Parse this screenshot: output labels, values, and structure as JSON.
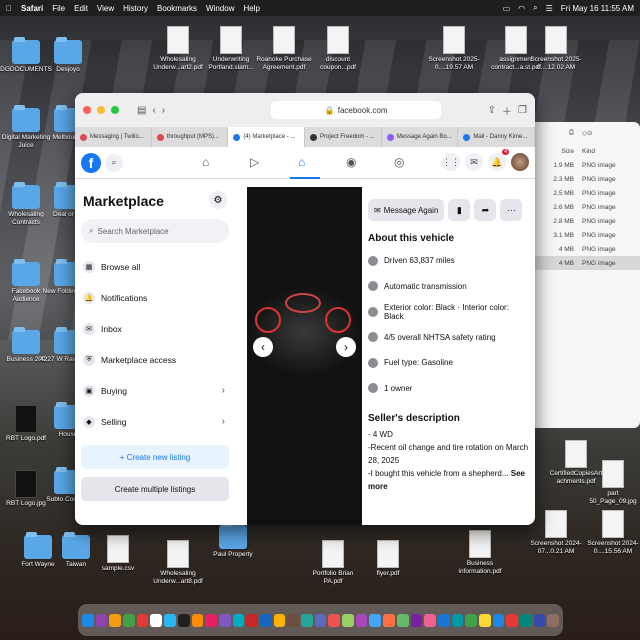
{
  "menubar": {
    "app": "Safari",
    "items": [
      "File",
      "Edit",
      "View",
      "History",
      "Bookmarks",
      "Window",
      "Help"
    ],
    "clock": "Fri May 16  11:55 AM"
  },
  "desktop": {
    "icons": [
      {
        "label": "DGDOCUMENTS",
        "kind": "folder"
      },
      {
        "label": "Desjoyo",
        "kind": "folder"
      },
      {
        "label": "Wholesaling Underw...art2.pdf",
        "kind": "doc"
      },
      {
        "label": "Underwriting Portland.slam...",
        "kind": "doc"
      },
      {
        "label": "Roanoke Purchase Agreement.pdf",
        "kind": "doc"
      },
      {
        "label": "discount coupon...pdf",
        "kind": "doc"
      },
      {
        "label": "Screenshot 2025-0....19.57 AM",
        "kind": "doc"
      },
      {
        "label": "assignment contract...a.st.pdf",
        "kind": "doc"
      },
      {
        "label": "Screenshot 2025-0....12.02 AM",
        "kind": "doc"
      },
      {
        "label": "Digital Marketing Juice",
        "kind": "folder"
      },
      {
        "label": "Melbourne",
        "kind": "folder"
      },
      {
        "label": "Wholesaling Contracts",
        "kind": "folder"
      },
      {
        "label": "Deal or no",
        "kind": "folder"
      },
      {
        "label": "Facebook Audience",
        "kind": "folder"
      },
      {
        "label": "New Folder Items",
        "kind": "folder"
      },
      {
        "label": "Business 200",
        "kind": "folder"
      },
      {
        "label": "4227 W Raven Tr...",
        "kind": "folder"
      },
      {
        "label": "RBT Logo.pdf",
        "kind": "doc"
      },
      {
        "label": "House",
        "kind": "folder"
      },
      {
        "label": "RBT Logo.jpg",
        "kind": "doc"
      },
      {
        "label": "Subto Contract",
        "kind": "folder"
      },
      {
        "label": "Fort Wayne",
        "kind": "folder"
      },
      {
        "label": "Taiwan",
        "kind": "folder"
      },
      {
        "label": "sample.csv",
        "kind": "doc"
      },
      {
        "label": "Wholesaling Underw...art8.pdf",
        "kind": "doc"
      },
      {
        "label": "Paul Property",
        "kind": "folder"
      },
      {
        "label": "Portfolio Brian PA.pdf",
        "kind": "doc"
      },
      {
        "label": "flyer.pdf",
        "kind": "doc"
      },
      {
        "label": "Business information.pdf",
        "kind": "doc"
      },
      {
        "label": "Screenshot 2024-07...0.21 AM",
        "kind": "doc"
      },
      {
        "label": "Screenshot 2024-0....15.56 AM",
        "kind": "doc"
      },
      {
        "label": "CertifiedCopiesArt achments.pdf",
        "kind": "doc"
      },
      {
        "label": "part 50_Page_09.jpg",
        "kind": "doc"
      }
    ]
  },
  "browser": {
    "url": "facebook.com",
    "tabs": [
      {
        "label": "Messaging | Twilio...",
        "color": "#e1474f"
      },
      {
        "label": "throughput (MPS)...",
        "color": "#e1474f"
      },
      {
        "label": "(4) Marketplace - ...",
        "color": "#1877f2"
      },
      {
        "label": "Project Freedom - ...",
        "color": "#333333"
      },
      {
        "label": "Message Again Bo...",
        "color": "#8b5cf6"
      },
      {
        "label": "Mail - Danny Kime...",
        "color": "#1877f2"
      }
    ],
    "notifications": "4"
  },
  "marketplace": {
    "title": "Marketplace",
    "search_placeholder": "Search Marketplace",
    "menu": [
      {
        "label": "Browse all",
        "icon": "store-icon",
        "chevron": false
      },
      {
        "label": "Notifications",
        "icon": "bell-icon",
        "chevron": false
      },
      {
        "label": "Inbox",
        "icon": "inbox-icon",
        "chevron": false
      },
      {
        "label": "Marketplace access",
        "icon": "shield-icon",
        "chevron": false
      },
      {
        "label": "Buying",
        "icon": "bag-icon",
        "chevron": true
      },
      {
        "label": "Selling",
        "icon": "tag-icon",
        "chevron": true
      }
    ],
    "new_listing": "+ Create new listing",
    "multiple_listings": "Create multiple listings"
  },
  "listing": {
    "message_button": "Message Again",
    "about_heading": "About this vehicle",
    "facts": [
      {
        "text": "Driven 63,837 miles",
        "icon": "speedometer-icon"
      },
      {
        "text": "Automatic transmission",
        "icon": "gear-icon"
      },
      {
        "text": "Exterior color: Black · Interior color: Black",
        "icon": "paint-icon"
      },
      {
        "text": "4/5 overall NHTSA safety rating",
        "icon": "star-icon"
      },
      {
        "text": "Fuel type: Gasoline",
        "icon": "fuel-icon"
      },
      {
        "text": "1 owner",
        "icon": "person-icon"
      }
    ],
    "seller_heading": "Seller's description",
    "description": [
      "- 4 WD",
      "-Recent oil change and tire rotation on March 28, 2025",
      "-I bought this vehicle from a shepherd..."
    ],
    "see_more": "See more"
  },
  "finder": {
    "headers": {
      "size": "Size",
      "kind": "Kind"
    },
    "rows": [
      {
        "size": "1.9 MB",
        "kind": "PNG image"
      },
      {
        "size": "2.3 MB",
        "kind": "PNG image"
      },
      {
        "size": "2.5 MB",
        "kind": "PNG image"
      },
      {
        "size": "2.6 MB",
        "kind": "PNG image"
      },
      {
        "size": "2.8 MB",
        "kind": "PNG image"
      },
      {
        "size": "3.1 MB",
        "kind": "PNG image"
      },
      {
        "size": "4 MB",
        "kind": "PNG image"
      },
      {
        "size": "4 MB",
        "kind": "PNG image"
      }
    ]
  }
}
